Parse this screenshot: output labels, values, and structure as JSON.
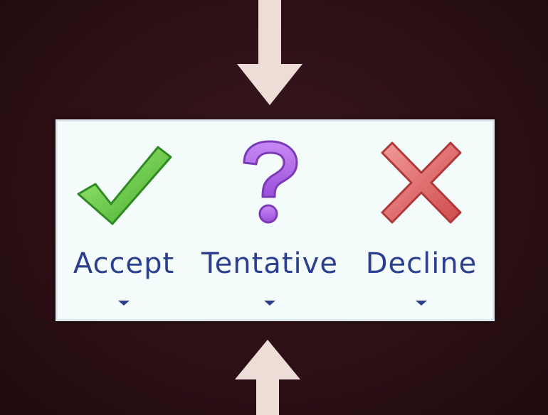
{
  "ribbon": {
    "buttons": [
      {
        "id": "accept",
        "label": "Accept",
        "icon": "checkmark-icon",
        "icon_color": "#5cc43c",
        "has_dropdown": true
      },
      {
        "id": "tentative",
        "label": "Tentative",
        "icon": "question-mark-icon",
        "icon_color": "#a860e0",
        "has_dropdown": true
      },
      {
        "id": "decline",
        "label": "Decline",
        "icon": "x-mark-icon",
        "icon_color": "#e06464",
        "has_dropdown": true
      }
    ],
    "label_color": "#2c3f8f",
    "background_color": "#f3fbfb"
  },
  "arrows": {
    "color": "#eeddd6",
    "top_direction": "down",
    "bottom_direction": "up"
  },
  "background_color": "#2c1016"
}
